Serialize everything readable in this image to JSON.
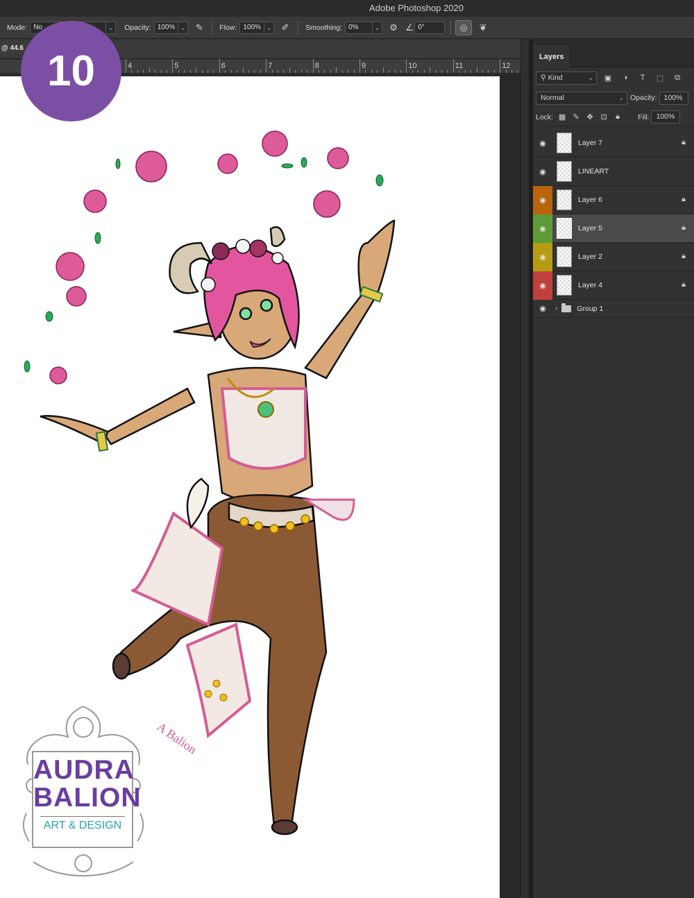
{
  "app": {
    "title": "Adobe Photoshop 2020"
  },
  "options_bar": {
    "mode_label": "Mode:",
    "mode_value": "No",
    "opacity_label": "Opacity:",
    "opacity_value": "100%",
    "flow_label": "Flow:",
    "flow_value": "100%",
    "smoothing_label": "Smoothing:",
    "smoothing_value": "0%",
    "angle_value": "0°",
    "icons": [
      "pressure-opacity-icon",
      "airbrush-icon",
      "gear-icon",
      "angle-icon",
      "pressure-size-icon",
      "symmetry-icon"
    ]
  },
  "document": {
    "zoom_label": "@ 44.6"
  },
  "ruler": {
    "marks": [
      "4",
      "5",
      "6",
      "7",
      "8",
      "9",
      "10",
      "11",
      "12"
    ]
  },
  "step_badge": {
    "number": "10",
    "color": "#7b4fa3"
  },
  "layers_panel": {
    "tab_label": "Layers",
    "filter_label": "Kind",
    "blend_mode": "Normal",
    "opacity_label": "Opacity:",
    "opacity_value": "100%",
    "lock_label": "Lock:",
    "fill_label": "Fill:",
    "fill_value": "100%",
    "layers": [
      {
        "name": "Layer 7",
        "color": "",
        "locked": true,
        "selected": false
      },
      {
        "name": "LINEART",
        "color": "",
        "locked": false,
        "selected": false
      },
      {
        "name": "Layer 6",
        "color": "#b8650c",
        "locked": true,
        "selected": false
      },
      {
        "name": "Layer 5",
        "color": "#5e9a38",
        "locked": true,
        "selected": true
      },
      {
        "name": "Layer 2",
        "color": "#b69c12",
        "locked": true,
        "selected": false
      },
      {
        "name": "Layer 4",
        "color": "#c0403e",
        "locked": true,
        "selected": false
      }
    ],
    "group": {
      "name": "Group 1"
    }
  },
  "logo": {
    "line1": "AUDRA",
    "line2": "BALION",
    "line3": "ART & DESIGN"
  }
}
